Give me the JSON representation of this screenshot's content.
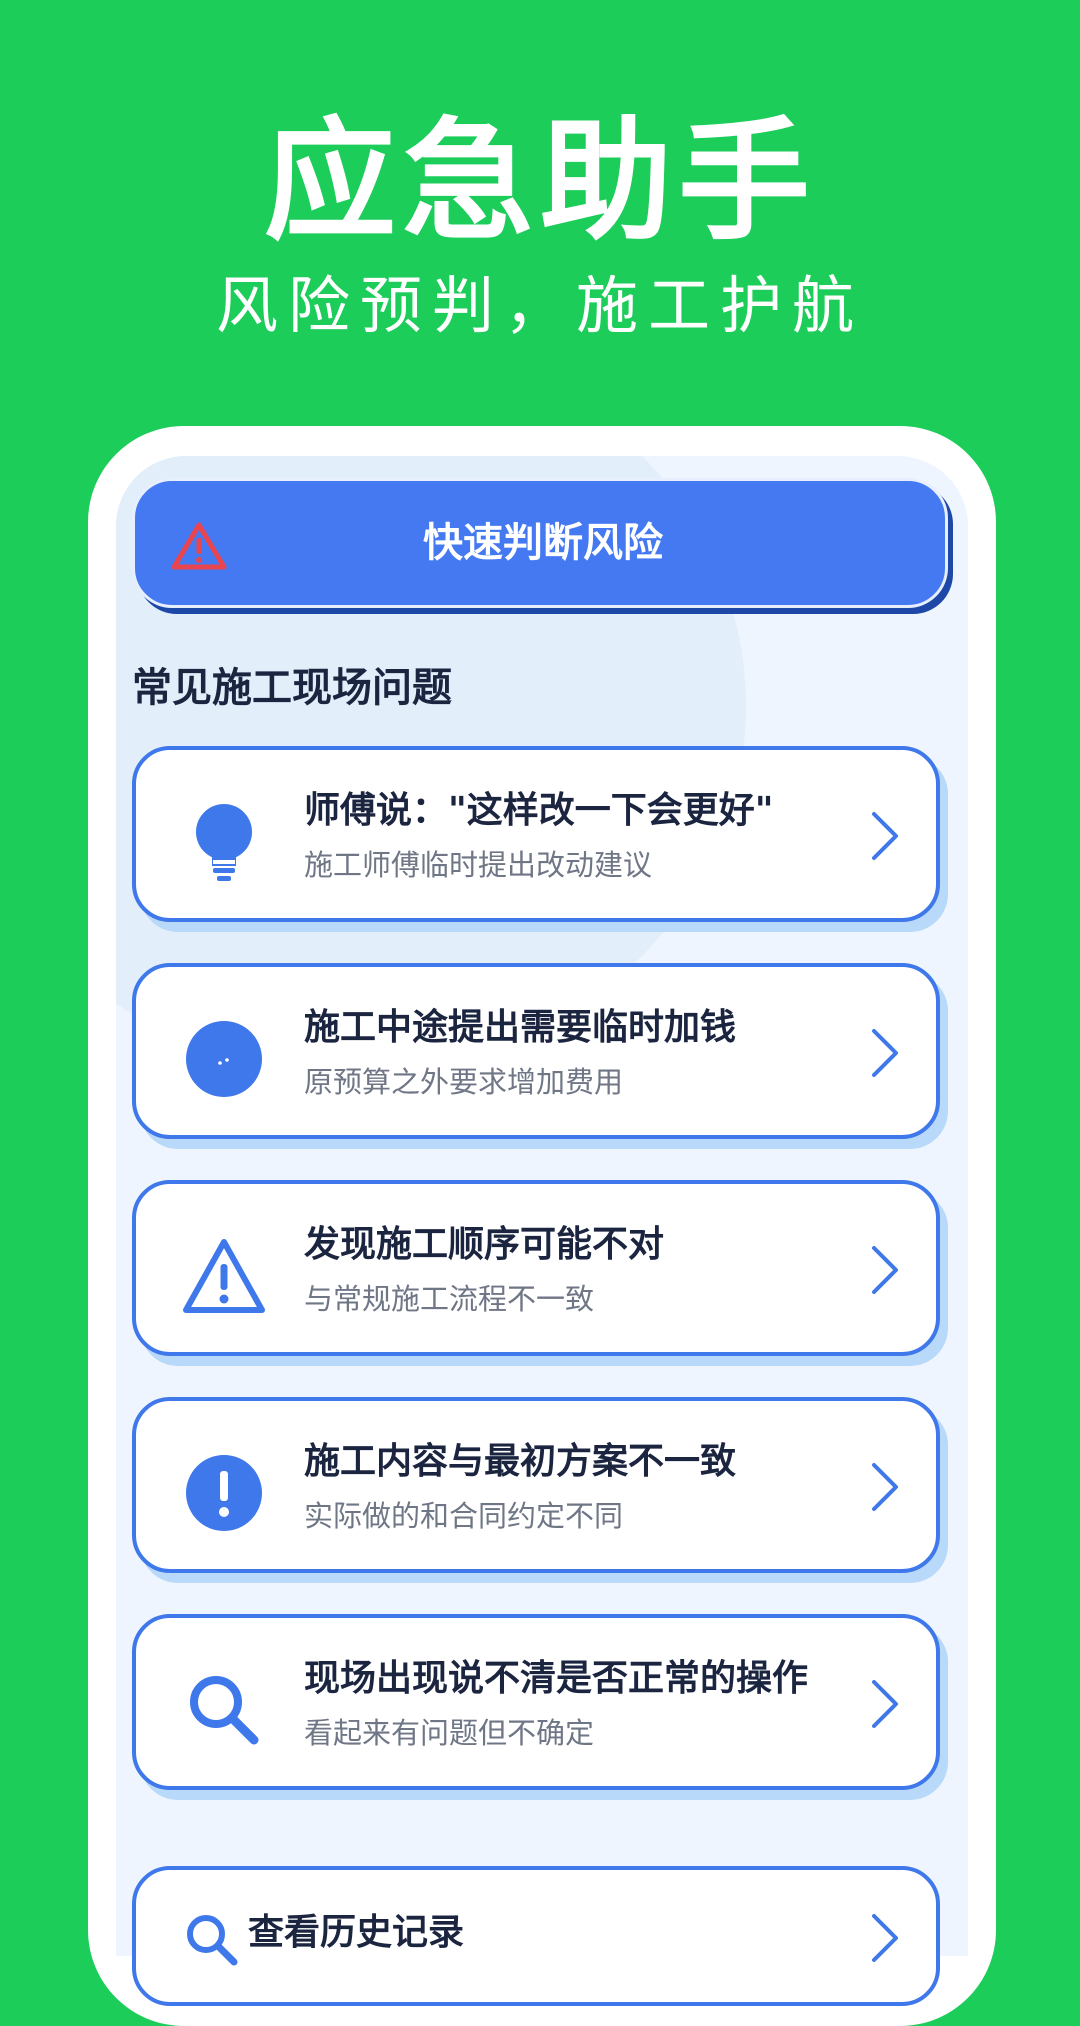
{
  "hero": {
    "title": "应急助手",
    "subtitle": "风险预判，施工护航"
  },
  "quick_action": {
    "label": "快速判断风险",
    "icon": "warning-triangle-icon"
  },
  "section_title": "常见施工现场问题",
  "cards": [
    {
      "title": "师傅说：\"这样改一下会更好\"",
      "desc": "施工师傅临时提出改动建议",
      "icon": "lightbulb-icon"
    },
    {
      "title": "施工中途提出需要临时加钱",
      "desc": "原预算之外要求增加费用",
      "icon": "money-circle-icon"
    },
    {
      "title": "发现施工顺序可能不对",
      "desc": "与常规施工流程不一致",
      "icon": "warning-triangle-icon"
    },
    {
      "title": "施工内容与最初方案不一致",
      "desc": "实际做的和合同约定不同",
      "icon": "exclamation-circle-icon"
    },
    {
      "title": "现场出现说不清是否正常的操作",
      "desc": "看起来有问题但不确定",
      "icon": "search-icon"
    }
  ],
  "history": {
    "label": "查看历史记录",
    "icon": "search-icon"
  },
  "colors": {
    "background": "#1ccd5a",
    "accent": "#4479f1",
    "card_border": "#3f78ea",
    "text_dark": "#1b2540",
    "text_muted": "#6f7685",
    "warning": "#e9454f"
  }
}
